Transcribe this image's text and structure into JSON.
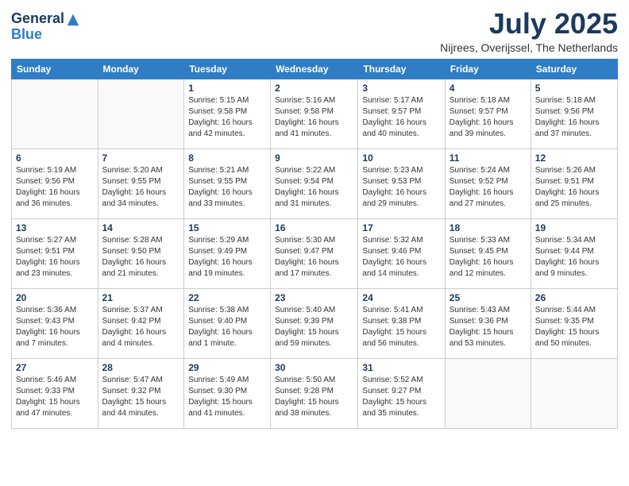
{
  "header": {
    "logo_general": "General",
    "logo_blue": "Blue",
    "title": "July 2025",
    "location": "Nijrees, Overijssel, The Netherlands"
  },
  "weekdays": [
    "Sunday",
    "Monday",
    "Tuesday",
    "Wednesday",
    "Thursday",
    "Friday",
    "Saturday"
  ],
  "weeks": [
    [
      {
        "day": "",
        "info": ""
      },
      {
        "day": "",
        "info": ""
      },
      {
        "day": "1",
        "info": "Sunrise: 5:15 AM\nSunset: 9:58 PM\nDaylight: 16 hours\nand 42 minutes."
      },
      {
        "day": "2",
        "info": "Sunrise: 5:16 AM\nSunset: 9:58 PM\nDaylight: 16 hours\nand 41 minutes."
      },
      {
        "day": "3",
        "info": "Sunrise: 5:17 AM\nSunset: 9:57 PM\nDaylight: 16 hours\nand 40 minutes."
      },
      {
        "day": "4",
        "info": "Sunrise: 5:18 AM\nSunset: 9:57 PM\nDaylight: 16 hours\nand 39 minutes."
      },
      {
        "day": "5",
        "info": "Sunrise: 5:18 AM\nSunset: 9:56 PM\nDaylight: 16 hours\nand 37 minutes."
      }
    ],
    [
      {
        "day": "6",
        "info": "Sunrise: 5:19 AM\nSunset: 9:56 PM\nDaylight: 16 hours\nand 36 minutes."
      },
      {
        "day": "7",
        "info": "Sunrise: 5:20 AM\nSunset: 9:55 PM\nDaylight: 16 hours\nand 34 minutes."
      },
      {
        "day": "8",
        "info": "Sunrise: 5:21 AM\nSunset: 9:55 PM\nDaylight: 16 hours\nand 33 minutes."
      },
      {
        "day": "9",
        "info": "Sunrise: 5:22 AM\nSunset: 9:54 PM\nDaylight: 16 hours\nand 31 minutes."
      },
      {
        "day": "10",
        "info": "Sunrise: 5:23 AM\nSunset: 9:53 PM\nDaylight: 16 hours\nand 29 minutes."
      },
      {
        "day": "11",
        "info": "Sunrise: 5:24 AM\nSunset: 9:52 PM\nDaylight: 16 hours\nand 27 minutes."
      },
      {
        "day": "12",
        "info": "Sunrise: 5:26 AM\nSunset: 9:51 PM\nDaylight: 16 hours\nand 25 minutes."
      }
    ],
    [
      {
        "day": "13",
        "info": "Sunrise: 5:27 AM\nSunset: 9:51 PM\nDaylight: 16 hours\nand 23 minutes."
      },
      {
        "day": "14",
        "info": "Sunrise: 5:28 AM\nSunset: 9:50 PM\nDaylight: 16 hours\nand 21 minutes."
      },
      {
        "day": "15",
        "info": "Sunrise: 5:29 AM\nSunset: 9:49 PM\nDaylight: 16 hours\nand 19 minutes."
      },
      {
        "day": "16",
        "info": "Sunrise: 5:30 AM\nSunset: 9:47 PM\nDaylight: 16 hours\nand 17 minutes."
      },
      {
        "day": "17",
        "info": "Sunrise: 5:32 AM\nSunset: 9:46 PM\nDaylight: 16 hours\nand 14 minutes."
      },
      {
        "day": "18",
        "info": "Sunrise: 5:33 AM\nSunset: 9:45 PM\nDaylight: 16 hours\nand 12 minutes."
      },
      {
        "day": "19",
        "info": "Sunrise: 5:34 AM\nSunset: 9:44 PM\nDaylight: 16 hours\nand 9 minutes."
      }
    ],
    [
      {
        "day": "20",
        "info": "Sunrise: 5:36 AM\nSunset: 9:43 PM\nDaylight: 16 hours\nand 7 minutes."
      },
      {
        "day": "21",
        "info": "Sunrise: 5:37 AM\nSunset: 9:42 PM\nDaylight: 16 hours\nand 4 minutes."
      },
      {
        "day": "22",
        "info": "Sunrise: 5:38 AM\nSunset: 9:40 PM\nDaylight: 16 hours\nand 1 minute."
      },
      {
        "day": "23",
        "info": "Sunrise: 5:40 AM\nSunset: 9:39 PM\nDaylight: 15 hours\nand 59 minutes."
      },
      {
        "day": "24",
        "info": "Sunrise: 5:41 AM\nSunset: 9:38 PM\nDaylight: 15 hours\nand 56 minutes."
      },
      {
        "day": "25",
        "info": "Sunrise: 5:43 AM\nSunset: 9:36 PM\nDaylight: 15 hours\nand 53 minutes."
      },
      {
        "day": "26",
        "info": "Sunrise: 5:44 AM\nSunset: 9:35 PM\nDaylight: 15 hours\nand 50 minutes."
      }
    ],
    [
      {
        "day": "27",
        "info": "Sunrise: 5:46 AM\nSunset: 9:33 PM\nDaylight: 15 hours\nand 47 minutes."
      },
      {
        "day": "28",
        "info": "Sunrise: 5:47 AM\nSunset: 9:32 PM\nDaylight: 15 hours\nand 44 minutes."
      },
      {
        "day": "29",
        "info": "Sunrise: 5:49 AM\nSunset: 9:30 PM\nDaylight: 15 hours\nand 41 minutes."
      },
      {
        "day": "30",
        "info": "Sunrise: 5:50 AM\nSunset: 9:28 PM\nDaylight: 15 hours\nand 38 minutes."
      },
      {
        "day": "31",
        "info": "Sunrise: 5:52 AM\nSunset: 9:27 PM\nDaylight: 15 hours\nand 35 minutes."
      },
      {
        "day": "",
        "info": ""
      },
      {
        "day": "",
        "info": ""
      }
    ]
  ]
}
